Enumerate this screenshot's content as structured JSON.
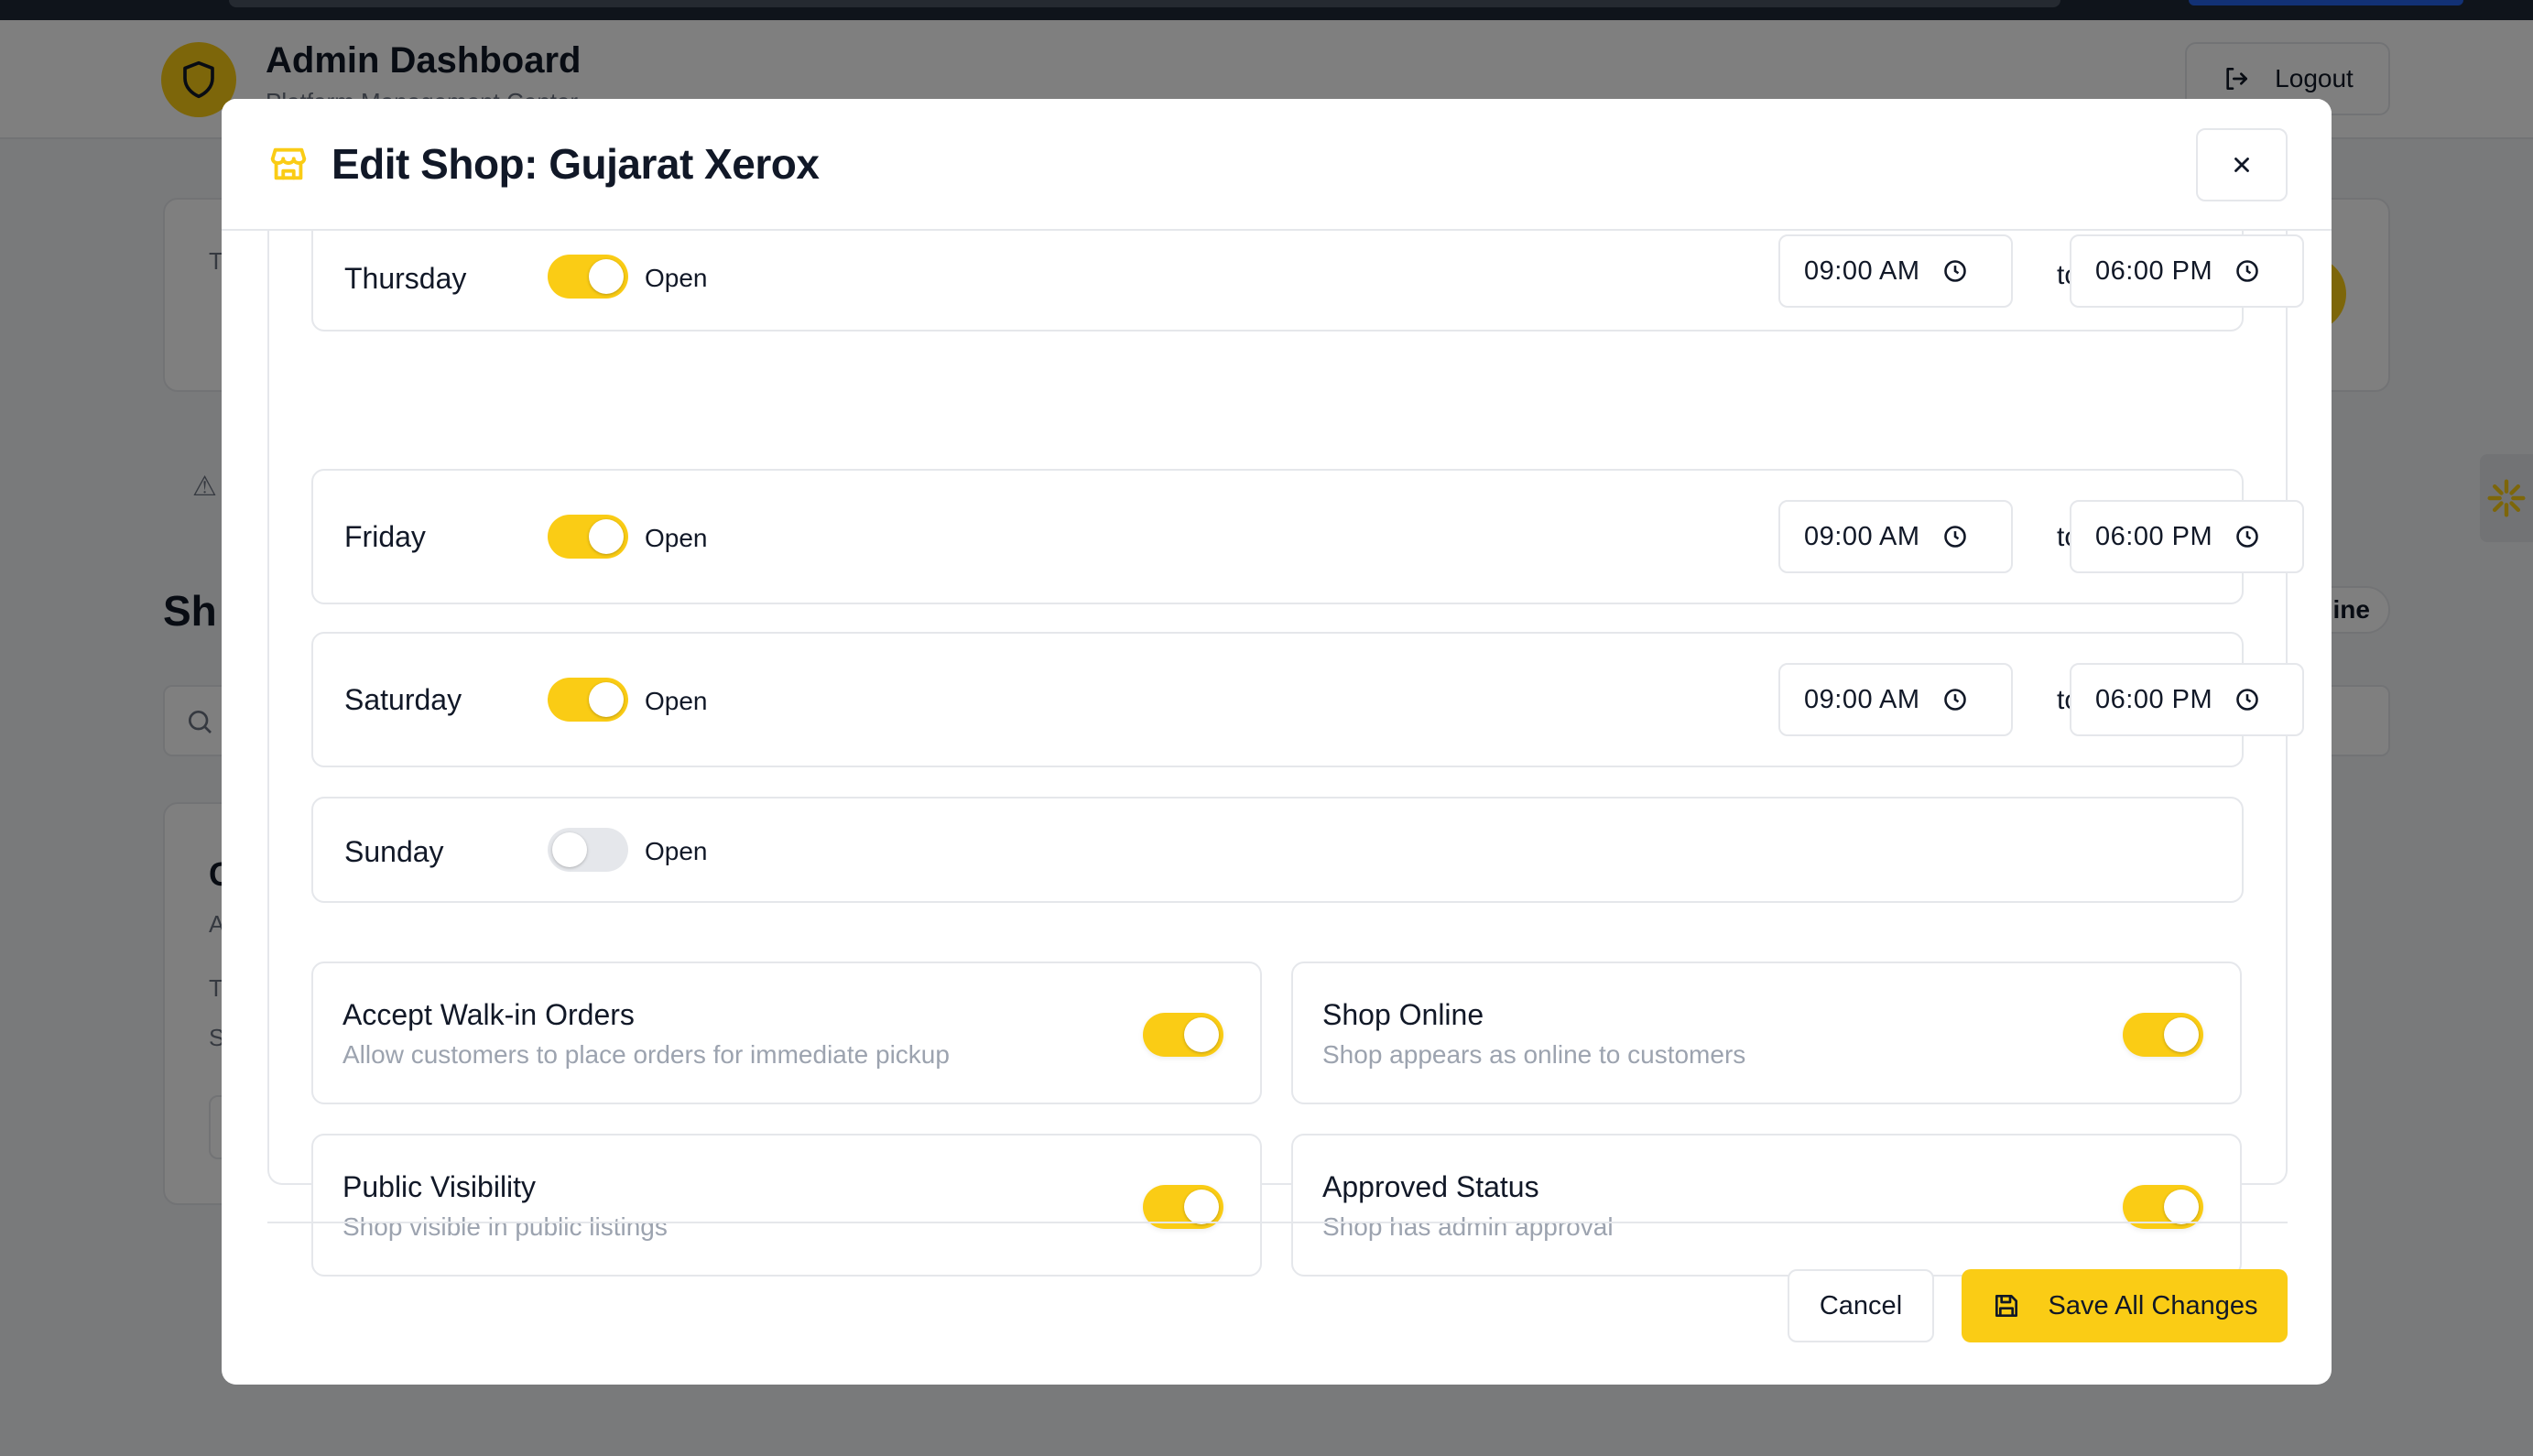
{
  "background": {
    "app_title": "Admin Dashboard",
    "app_subtitle": "Platform Management Center",
    "logout_label": "Logout",
    "section_heading_partial": "Sh",
    "pill_partial": "ine",
    "card_letter_1": "T",
    "card_letter_2": "C",
    "card_letter_3": "A",
    "card_letter_4": "T",
    "card_letter_5": "S"
  },
  "modal": {
    "title": "Edit Shop: Gujarat Xerox",
    "title_icon": "store-icon",
    "close_icon": "close-icon",
    "days": [
      {
        "name": "Thursday",
        "open": true,
        "status_label": "Open",
        "from": "09:00 AM",
        "to": "06:00 PM"
      },
      {
        "name": "Friday",
        "open": true,
        "status_label": "Open",
        "from": "09:00 AM",
        "to": "06:00 PM"
      },
      {
        "name": "Saturday",
        "open": true,
        "status_label": "Open",
        "from": "09:00 AM",
        "to": "06:00 PM"
      },
      {
        "name": "Sunday",
        "open": false,
        "status_label": "Open"
      }
    ],
    "to_label": "to",
    "options": [
      {
        "title": "Accept Walk-in Orders",
        "description": "Allow customers to place orders for immediate pickup",
        "enabled": true
      },
      {
        "title": "Shop Online",
        "description": "Shop appears as online to customers",
        "enabled": true
      },
      {
        "title": "Public Visibility",
        "description": "Shop visible in public listings",
        "enabled": true
      },
      {
        "title": "Approved Status",
        "description": "Shop has admin approval",
        "enabled": true
      }
    ],
    "cancel_label": "Cancel",
    "save_label": "Save All Changes"
  },
  "colors": {
    "accent": "#facc15",
    "toggle_off": "#e5e7eb",
    "muted_text": "#9ca3af"
  }
}
